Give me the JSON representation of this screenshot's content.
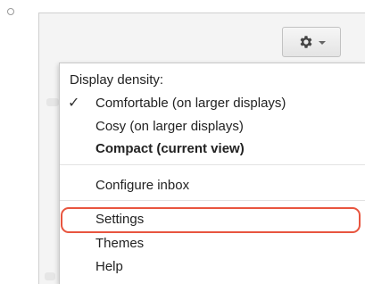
{
  "gear_button": {
    "icon": "gear-icon",
    "dropdown_icon": "caret-down-icon"
  },
  "menu": {
    "section_header": "Display density:",
    "density_options": [
      {
        "label": "Comfortable (on larger displays)",
        "checked": true
      },
      {
        "label": "Cosy (on larger displays)",
        "checked": false
      },
      {
        "label": "Compact (current view)",
        "checked": false,
        "bold": true
      }
    ],
    "configure_inbox": "Configure inbox",
    "settings": "Settings",
    "themes": "Themes",
    "help": "Help",
    "check_glyph": "✓"
  },
  "colors": {
    "highlight": "#e8553f"
  }
}
